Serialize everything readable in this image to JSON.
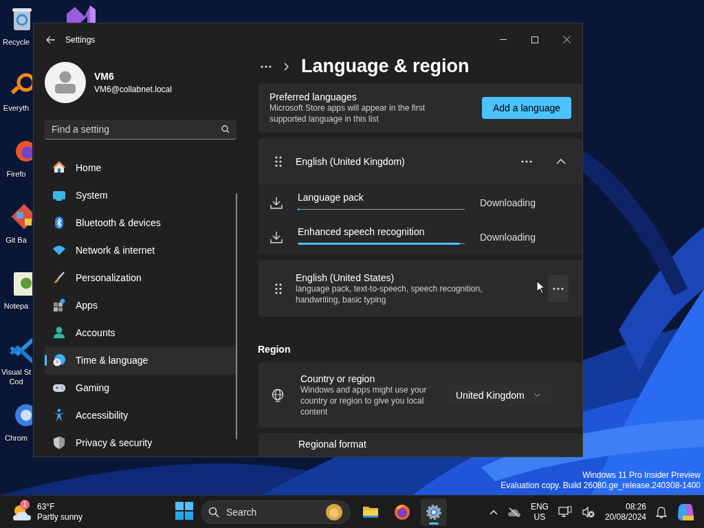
{
  "desktop": {
    "icons": [
      {
        "label": "Recycle"
      },
      {
        "label": "Everyth"
      },
      {
        "label": "Firefo"
      },
      {
        "label": "Git Ba"
      },
      {
        "label": "Notepa"
      },
      {
        "label": "Visual St\nCod"
      },
      {
        "label": "Chrom"
      }
    ],
    "watermark": [
      "Windows 11 Pro Insider Preview",
      "Evaluation copy. Build 26080.ge_release.240308-1400"
    ]
  },
  "window": {
    "title": "Settings",
    "user": {
      "name": "VM6",
      "email": "VM6@collabnet.local"
    },
    "search": {
      "placeholder": "Find a setting"
    },
    "sidebar": {
      "items": [
        {
          "label": "Home",
          "selected": false
        },
        {
          "label": "System",
          "selected": false
        },
        {
          "label": "Bluetooth & devices",
          "selected": false
        },
        {
          "label": "Network & internet",
          "selected": false
        },
        {
          "label": "Personalization",
          "selected": false
        },
        {
          "label": "Apps",
          "selected": false
        },
        {
          "label": "Accounts",
          "selected": false
        },
        {
          "label": "Time & language",
          "selected": true
        },
        {
          "label": "Gaming",
          "selected": false
        },
        {
          "label": "Accessibility",
          "selected": false
        },
        {
          "label": "Privacy & security",
          "selected": false
        }
      ]
    },
    "page": {
      "title": "Language & region",
      "preferred": {
        "title": "Preferred languages",
        "description": "Microsoft Store apps will appear in the first supported language in this list",
        "button": "Add a language"
      },
      "languages": [
        {
          "name": "English (United Kingdom)",
          "features": [
            {
              "label": "Language pack",
              "level": 0.01,
              "status": "Downloading"
            },
            {
              "label": "Enhanced speech recognition",
              "level": 0.97,
              "status": "Downloading"
            }
          ]
        },
        {
          "name": "English (United States)",
          "description": "language pack, text-to-speech, speech recognition, handwriting, basic typing"
        }
      ],
      "region_heading": "Region",
      "country": {
        "title": "Country or region",
        "description": "Windows and apps might use your country or region to give you local content",
        "value": "United Kingdom"
      },
      "regional_format": {
        "title": "Regional format"
      }
    }
  },
  "taskbar": {
    "weather": {
      "badge": "1",
      "temperature": "63°F",
      "condition": "Partly sunny"
    },
    "search": {
      "placeholder": "Search"
    },
    "apps": [
      {
        "kind": "explorer",
        "selected": false
      },
      {
        "kind": "firefox",
        "selected": false
      },
      {
        "kind": "settings",
        "selected": true
      }
    ],
    "tray": {
      "language": "ENG",
      "region": "US",
      "time": "08:26",
      "date": "20/08/2024"
    }
  }
}
